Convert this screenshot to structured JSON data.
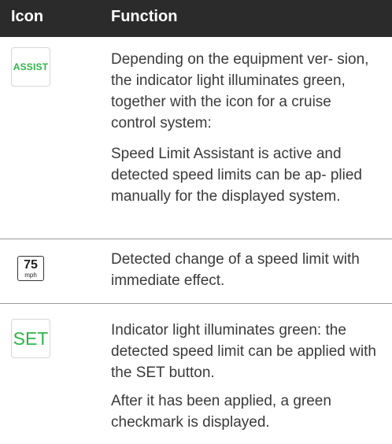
{
  "header": {
    "icon": "Icon",
    "function": "Function"
  },
  "rows": [
    {
      "icon_text": "ASSIST",
      "paragraphs": [
        "Depending on the equipment ver- sion, the indicator light illuminates green, together with the icon for a cruise control system:",
        "Speed Limit Assistant is active and detected speed limits can be ap- plied manually for the displayed system."
      ]
    },
    {
      "icon_number": "75",
      "icon_unit": "mph",
      "paragraphs": [
        "Detected change of a speed limit with immediate effect."
      ]
    },
    {
      "icon_text": "SET",
      "paragraphs": [
        "Indicator light illuminates green: the detected speed limit can be applied with the SET button.",
        "After it has been applied, a green checkmark is displayed."
      ]
    }
  ],
  "colors": {
    "header_bg": "#2b2b2b",
    "indicator_green": "#2fb64a",
    "divider": "#9a9a9a"
  }
}
